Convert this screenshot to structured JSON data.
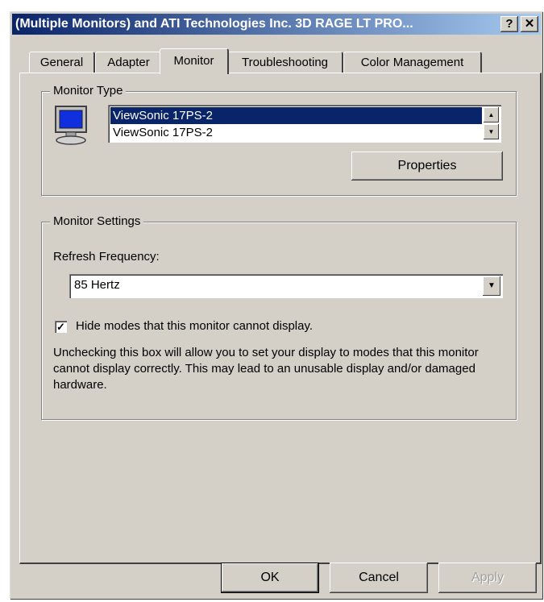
{
  "window": {
    "title": "(Multiple Monitors) and ATI Technologies Inc. 3D RAGE LT PRO...",
    "help_glyph": "?",
    "close_glyph": "✕"
  },
  "tabs": [
    {
      "label": "General",
      "active": false
    },
    {
      "label": "Adapter",
      "active": false
    },
    {
      "label": "Monitor",
      "active": true
    },
    {
      "label": "Troubleshooting",
      "active": false
    },
    {
      "label": "Color Management",
      "active": false
    }
  ],
  "monitor_type": {
    "group_label": "Monitor Type",
    "items": [
      "ViewSonic 17PS-2",
      "ViewSonic 17PS-2"
    ],
    "selected_index": 0,
    "properties_label": "Properties",
    "icon": "monitor-icon"
  },
  "monitor_settings": {
    "group_label": "Monitor Settings",
    "refresh_label": "Refresh Frequency:",
    "refresh_value": "85 Hertz",
    "hide_modes_label": "Hide modes that this monitor cannot display.",
    "hide_modes_checked": true,
    "description": "Unchecking this box will allow you to set your display to modes that this monitor cannot display correctly. This may lead to an unusable display and/or damaged hardware."
  },
  "buttons": {
    "ok": "OK",
    "cancel": "Cancel",
    "apply": "Apply"
  },
  "colors": {
    "face": "#d4d0c8",
    "title_start": "#0a246a",
    "title_end": "#a6caf0",
    "selection": "#0a246a"
  }
}
